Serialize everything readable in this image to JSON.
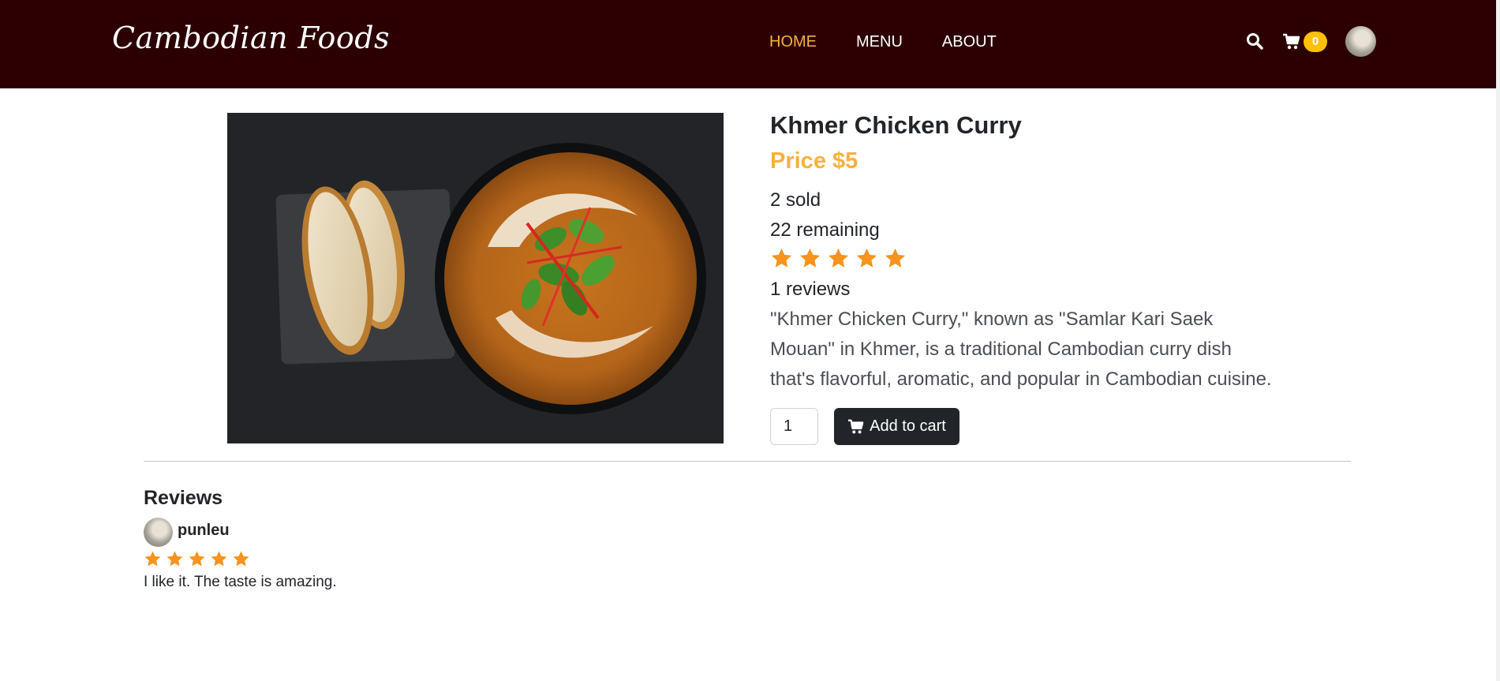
{
  "nav": {
    "brand": "Cambodian Foods",
    "links": [
      {
        "label": "HOME",
        "active": true
      },
      {
        "label": "MENU",
        "active": false
      },
      {
        "label": "ABOUT",
        "active": false
      }
    ],
    "cart_count": "0",
    "search_icon": "search-icon",
    "cart_icon": "cart-icon"
  },
  "product": {
    "title": "Khmer Chicken Curry",
    "price": "Price $5",
    "sold": "2 sold",
    "remaining": "22 remaining",
    "rating": 5,
    "rating_max": 5,
    "reviews_count": "1 reviews",
    "description": "\"Khmer Chicken Curry,\" known as \"Samlar Kari Saek Mouan\" in Khmer, is a traditional Cambodian curry dish that's flavorful, aromatic, and popular in Cambodian cuisine.",
    "quantity": "1",
    "add_to_cart_label": "Add to cart"
  },
  "reviews": {
    "heading": "Reviews",
    "items": [
      {
        "user": "punleu",
        "rating": 5,
        "text": "I like it. The taste is amazing."
      }
    ]
  },
  "colors": {
    "navbar_bg": "#2c0002",
    "accent": "#f8b03f",
    "star": "#f7931e",
    "badge": "#ffc107",
    "button_dark": "#212529"
  }
}
